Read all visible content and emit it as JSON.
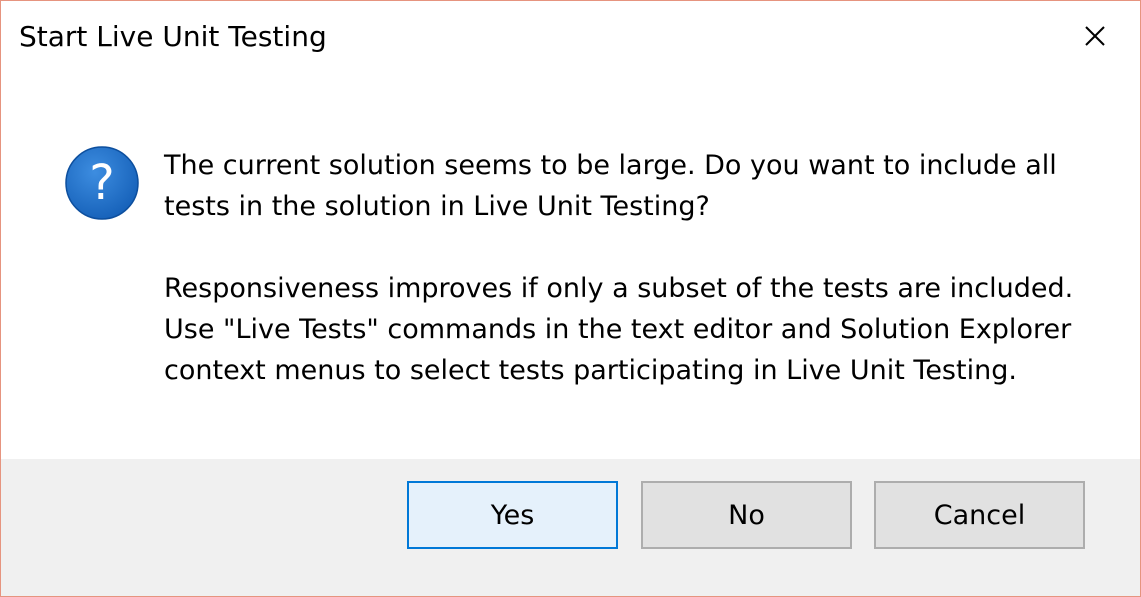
{
  "dialog": {
    "title": "Start Live Unit Testing",
    "icon": "question-icon",
    "message": {
      "paragraph1": "The current solution seems to be large. Do you want to include all tests in the solution in Live Unit Testing?",
      "paragraph2": "Responsiveness improves if only a subset of the tests are included. Use \"Live Tests\" commands in the text editor and Solution Explorer context menus to select tests participating in Live Unit Testing."
    },
    "buttons": {
      "yes": "Yes",
      "no": "No",
      "cancel": "Cancel"
    },
    "colors": {
      "accent": "#0078d7",
      "icon_blue": "#1d6fc8",
      "footer_bg": "#f0f0f0",
      "window_border": "#e6947f"
    }
  }
}
